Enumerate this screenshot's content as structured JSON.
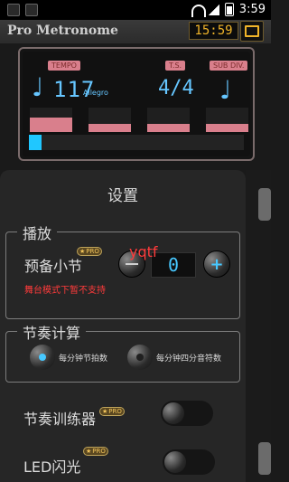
{
  "statusbar": {
    "time": "3:59"
  },
  "app": {
    "title": "Pro Metronome",
    "time_display": "15:59"
  },
  "metronome": {
    "labels": {
      "tempo": "TEMPO",
      "ts": "T.S.",
      "sub_div": "SUB DIV."
    },
    "tempo_value": "117",
    "tempo_name": "Allegro",
    "time_signature": "4/4",
    "beats": [
      {
        "level": 0.58
      },
      {
        "level": 0.35
      },
      {
        "level": 0.35
      },
      {
        "level": 0.35
      }
    ],
    "progress": 0.06
  },
  "settings": {
    "title": "设置",
    "play": {
      "title": "播放",
      "pre_measure_label": "预备小节",
      "pre_measure_value": "0",
      "stage_mode_notice": "舞台模式下暂不支持",
      "overlay_text": "yqtf"
    },
    "rhythm": {
      "title": "节奏计算",
      "options": [
        {
          "label": "每分钟节拍数",
          "selected": true
        },
        {
          "label": "每分钟四分音符数",
          "selected": false
        }
      ]
    },
    "trainer_label": "节奏训练器",
    "led_label": "LED闪光",
    "pro_badge": "PRO"
  },
  "colors": {
    "accent_blue": "#47c8ff",
    "pink": "#d97f8c",
    "gold": "#f0b429",
    "red": "#ff3b3b"
  }
}
